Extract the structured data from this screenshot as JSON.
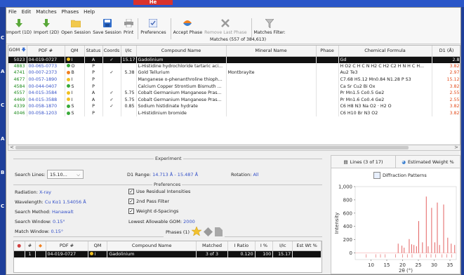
{
  "bg": {
    "red_badge": "He",
    "left_letters": [
      "C",
      "A",
      "C",
      "A",
      "B",
      "C"
    ]
  },
  "menu": [
    "File",
    "Edit",
    "Matches",
    "Phases",
    "Help"
  ],
  "toolbar": {
    "buttons": [
      {
        "label": "Import (1D)",
        "icon": "arrow-down-icon"
      },
      {
        "label": "Import (2D)",
        "icon": "arrow-down-icon"
      },
      {
        "label": "Open Session",
        "icon": "folder-icon"
      },
      {
        "label": "Save Session",
        "icon": "save-icon"
      },
      {
        "label": "Print",
        "icon": "print-icon"
      },
      {
        "label": "Preferences",
        "icon": "preferences-icon"
      },
      {
        "label": "Accept Phase",
        "icon": "accept-phase-icon"
      },
      {
        "label": "Remove Last Phase",
        "icon": "remove-icon"
      },
      {
        "label": "Matches Filter:",
        "icon": "filter-icon"
      }
    ],
    "matches_count": "Matches (557 of 384,613)"
  },
  "matches": {
    "columns": [
      "GOM",
      "PDF #",
      "QM",
      "Status",
      "Coords",
      "I/Ic",
      "Compound Name",
      "Mineral Name",
      "Phase",
      "Chemical Formula",
      "D1 (Å)"
    ],
    "rows": [
      {
        "gom": "5023",
        "pdf": "04-019-0727",
        "qm_dot": "y",
        "qm": "I",
        "status": "A",
        "coords": "✓",
        "iic": "15.17",
        "compound": "Gadolinium",
        "mineral": "",
        "phase": "",
        "formula": "Gd",
        "d1": "2.8",
        "selected": true
      },
      {
        "gom": "4883",
        "pdf": "00-065-0773",
        "qm_dot": "g",
        "qm": "O",
        "status": "P",
        "coords": "",
        "iic": "",
        "compound": "L-Histidine hydrochloride tartaric aci...",
        "mineral": "",
        "phase": "",
        "formula": "H O2 C H C N H2 C H2 C2 H N H C H...",
        "d1": "3.82"
      },
      {
        "gom": "4741",
        "pdf": "00-007-2373",
        "qm_dot": "o",
        "qm": "B",
        "status": "P",
        "coords": "✓",
        "iic": "5.38",
        "compound": "Gold Tellurium",
        "mineral": "Montbrayite",
        "phase": "",
        "formula": "Au2 Te3",
        "d1": "2.97"
      },
      {
        "gom": "4677",
        "pdf": "00-057-1890",
        "qm_dot": "y",
        "qm": "I",
        "status": "P",
        "coords": "",
        "iic": "",
        "compound": "Manganese o-phenanthroline thioph...",
        "mineral": "",
        "phase": "",
        "formula": "C7.68 H5.12 Mn0.84 N1.28 P S3",
        "d1": "15.12"
      },
      {
        "gom": "4584",
        "pdf": "00-044-0407",
        "qm_dot": "g",
        "qm": "S",
        "status": "P",
        "coords": "",
        "iic": "",
        "compound": "Calcium Copper Strontium Bismuth ...",
        "mineral": "",
        "phase": "",
        "formula": "Ca Sr Cu2 Bi Ox",
        "d1": "3.82"
      },
      {
        "gom": "4557",
        "pdf": "04-015-3584",
        "qm_dot": "y",
        "qm": "I",
        "status": "A",
        "coords": "✓",
        "iic": "5.75",
        "compound": "Cobalt Germanium Manganese Pras...",
        "mineral": "",
        "phase": "",
        "formula": "Pr Mn1.5 Co0.5 Ge2",
        "d1": "2.55"
      },
      {
        "gom": "4469",
        "pdf": "04-015-3588",
        "qm_dot": "y",
        "qm": "I",
        "status": "A",
        "coords": "✓",
        "iic": "5.75",
        "compound": "Cobalt Germanium Manganese Pras...",
        "mineral": "",
        "phase": "",
        "formula": "Pr Mn1.6 Co0.4 Ge2",
        "d1": "2.55"
      },
      {
        "gom": "4339",
        "pdf": "00-058-1870",
        "qm_dot": "g",
        "qm": "S",
        "status": "P",
        "coords": "✓",
        "iic": "0.85",
        "compound": "Sodium histidinate hydrate",
        "mineral": "",
        "phase": "",
        "formula": "C6 H8 N3 Na O2 · H2 O",
        "d1": "3.82"
      },
      {
        "gom": "4046",
        "pdf": "00-058-1203",
        "qm_dot": "g",
        "qm": "S",
        "status": "P",
        "coords": "",
        "iic": "",
        "compound": "L-Histidinium bromide",
        "mineral": "",
        "phase": "",
        "formula": "C6 H10 Br N3 O2",
        "d1": "3.82"
      }
    ]
  },
  "settings": {
    "experiment_title": "Experiment",
    "search_lines_label": "Search Lines:",
    "search_lines_value": "15.10...",
    "d1_range_label": "D1 Range:",
    "d1_range_value": "14.713 Å - 15.487 Å",
    "rotation_label": "Rotation:",
    "rotation_value": "All",
    "preferences_title": "Preferences",
    "radiation_label": "Radiation:",
    "radiation_value": "X-ray",
    "wavelength_label": "Wavelength:",
    "wavelength_value": "Cu Kα1 1.54056 Å",
    "search_method_label": "Search Method:",
    "search_method_value": "Hanawalt",
    "search_window_label": "Search Window:",
    "search_window_value": "0.15°",
    "match_window_label": "Match Window:",
    "match_window_value": "0.15°",
    "chk_residual": "Use Residual Intensities",
    "chk_2pass": "2nd Pass Filter",
    "chk_weight": "Weight d-Spacings",
    "lowest_gom_label": "Lowest Allowable GOM:",
    "lowest_gom_value": "2000",
    "phases_title": "Phases (1)"
  },
  "phases": {
    "columns": [
      "",
      "#",
      "",
      "PDF #",
      "QM",
      "Compound Name",
      "Matched",
      "I Ratio",
      "I %",
      "I/Ic",
      "Est Wt %"
    ],
    "rows": [
      {
        "num": "1",
        "pdf": "04-019-0727",
        "qm": "I",
        "compound": "Gadolinium",
        "matched": "3 of 3",
        "iratio": "0.120",
        "ipct": "100",
        "iic": "15.17",
        "estwt": ""
      }
    ]
  },
  "rpanel": {
    "tab_lines": "Lines (3 of 17)",
    "tab_weight": "Estimated Weight %",
    "diffraction_btn": "Diffraction Patterns"
  },
  "chart_data": {
    "type": "bar",
    "ylabel": "Intensity",
    "xlabel": "2θ (°)",
    "ylim": [
      -100,
      1000
    ],
    "xlim": [
      5,
      37
    ],
    "yticks": [
      0,
      200,
      400,
      600,
      800,
      "1,000"
    ],
    "xticks": [
      10,
      15,
      20,
      25,
      30,
      35
    ],
    "peaks": [
      {
        "x": 18.6,
        "y": 140
      },
      {
        "x": 19.8,
        "y": 110
      },
      {
        "x": 20.5,
        "y": 80
      },
      {
        "x": 22.1,
        "y": 210
      },
      {
        "x": 22.9,
        "y": 130
      },
      {
        "x": 23.6,
        "y": 120
      },
      {
        "x": 24.4,
        "y": 100
      },
      {
        "x": 25.1,
        "y": 480
      },
      {
        "x": 26.3,
        "y": 160
      },
      {
        "x": 27.5,
        "y": 850
      },
      {
        "x": 28.1,
        "y": 100
      },
      {
        "x": 29.2,
        "y": 680
      },
      {
        "x": 30.2,
        "y": 160
      },
      {
        "x": 31.0,
        "y": 760
      },
      {
        "x": 31.7,
        "y": 120
      },
      {
        "x": 33.0,
        "y": 730
      },
      {
        "x": 34.3,
        "y": 230
      },
      {
        "x": 35.4,
        "y": 140
      },
      {
        "x": 36.5,
        "y": 120
      }
    ],
    "ref_ticks": [
      8.5,
      11.5,
      13.0,
      14.5,
      17.8,
      20.0,
      21.5,
      23.0,
      25.5,
      27.5,
      29.0,
      30.5,
      32.5,
      34.0,
      35.5
    ]
  }
}
